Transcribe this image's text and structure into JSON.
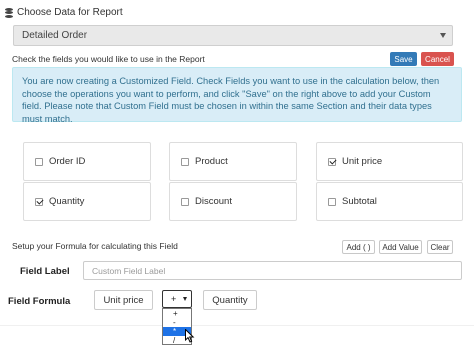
{
  "header": {
    "icon": "database-icon",
    "title": "Choose Data for Report"
  },
  "report_select": {
    "selected": "Detailed Order"
  },
  "fields_section": {
    "instruction": "Check the fields you would like to use in the Report",
    "save_label": "Save",
    "cancel_label": "Cancel"
  },
  "info": {
    "text": "You are now creating a Customized Field. Check Fields you want to use in the calculation below, then choose the operations you want to perform, and click \"Save\" on the right above to add your Custom field. Please note that Custom Field must be chosen in within the same Section and their data types must match."
  },
  "fields": [
    {
      "label": "Order ID",
      "checked": false
    },
    {
      "label": "Product",
      "checked": false
    },
    {
      "label": "Unit price",
      "checked": true
    },
    {
      "label": "Quantity",
      "checked": true
    },
    {
      "label": "Discount",
      "checked": false
    },
    {
      "label": "Subtotal",
      "checked": false
    }
  ],
  "formula_setup": {
    "label": "Setup your Formula for calculating this Field",
    "add_paren_label": "Add ( )",
    "add_value_label": "Add Value",
    "clear_label": "Clear"
  },
  "field_label": {
    "label": "Field Label",
    "placeholder": "Custom Field Label",
    "value": ""
  },
  "field_formula": {
    "label": "Field Formula",
    "token_1": "Unit price",
    "operator_selected": "+",
    "operator_options": [
      "+",
      "-",
      "*",
      "/"
    ],
    "highlighted_option": "*",
    "token_2": "Quantity"
  },
  "colors": {
    "save": "#337ab7",
    "cancel": "#d9534f",
    "info_bg": "#d9edf7",
    "info_text": "#31708f",
    "highlight": "#1e72e6"
  }
}
